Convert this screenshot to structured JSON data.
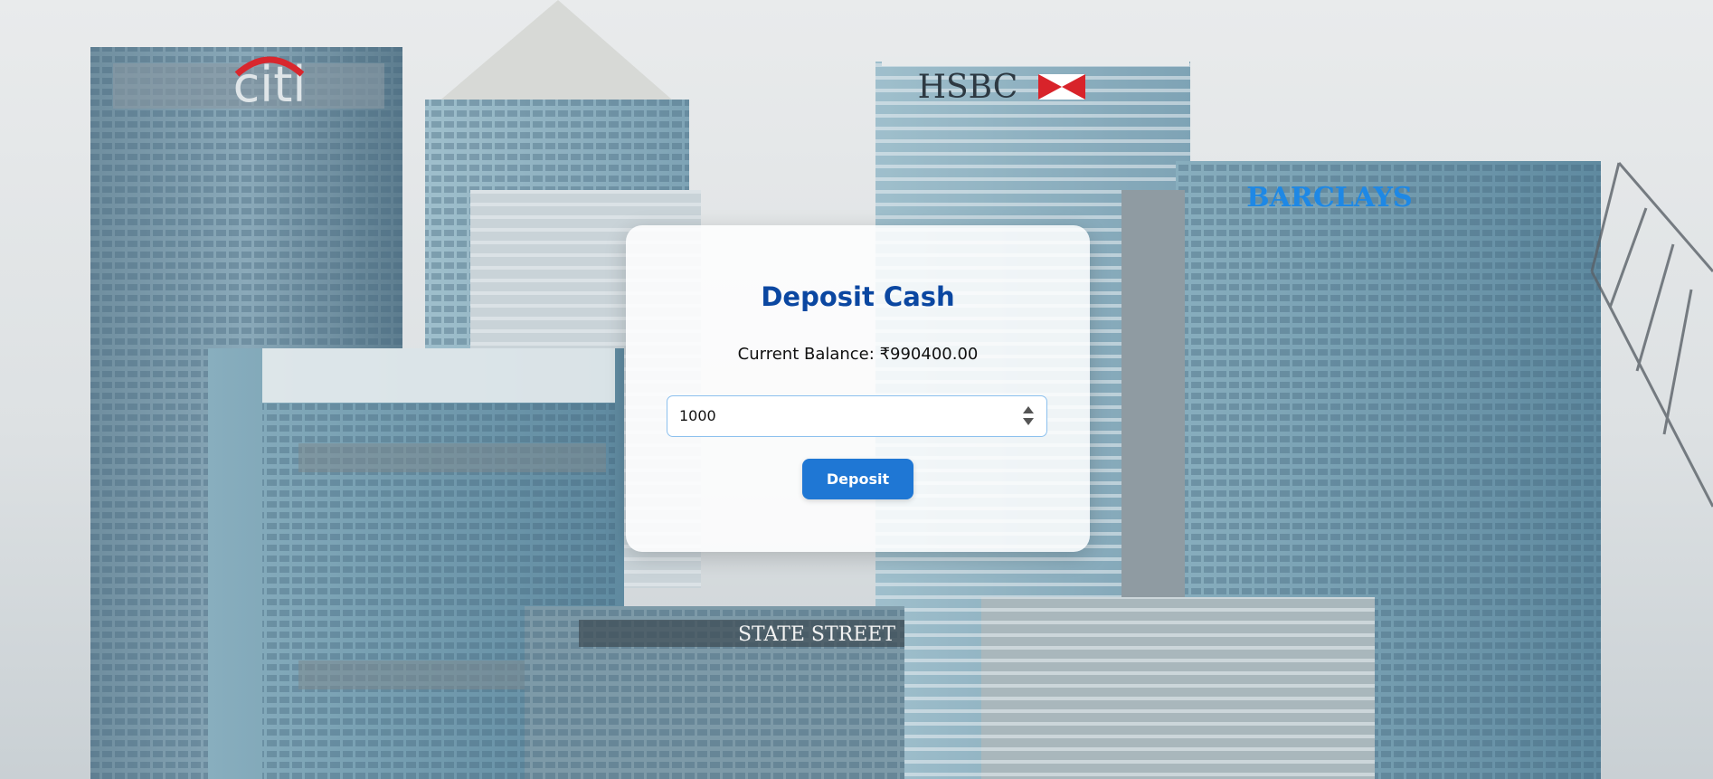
{
  "background": {
    "logos": {
      "citi": "citi",
      "hsbc": "HSBC",
      "barclays": "BARCLAYS",
      "state_street": "STATE STREET"
    }
  },
  "deposit": {
    "title": "Deposit Cash",
    "balance_label": "Current Balance:",
    "balance_value": "₹990400.00",
    "amount_value": "1000",
    "button_label": "Deposit"
  },
  "colors": {
    "title": "#0b47a1",
    "button": "#1f77d4",
    "input_border": "#8cc0ee"
  }
}
